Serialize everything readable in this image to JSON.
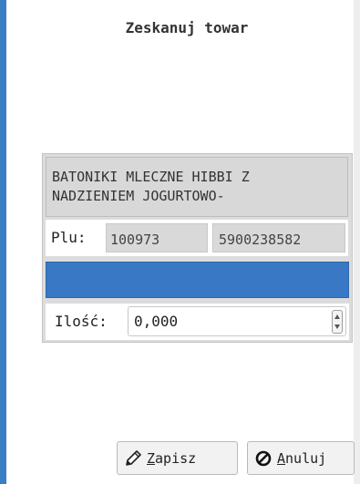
{
  "dialog": {
    "title": "Zeskanuj towar"
  },
  "product": {
    "name": "BATONIKI MLECZNE HIBBI Z\nNADZIENIEM JOGURTOWO-",
    "plu_label": "Plu:",
    "plu_value": "100973",
    "ean_value": "5900238582"
  },
  "quantity": {
    "label": "Ilość:",
    "value": "0,000"
  },
  "buttons": {
    "save": {
      "first_letter": "Z",
      "rest": "apisz",
      "icon": "pencil-icon"
    },
    "cancel": {
      "first_letter": "A",
      "rest": "nuluj",
      "icon": "cancel-circle-icon"
    }
  },
  "colors": {
    "accent": "#3878c4",
    "panel": "#dcdcdc"
  }
}
